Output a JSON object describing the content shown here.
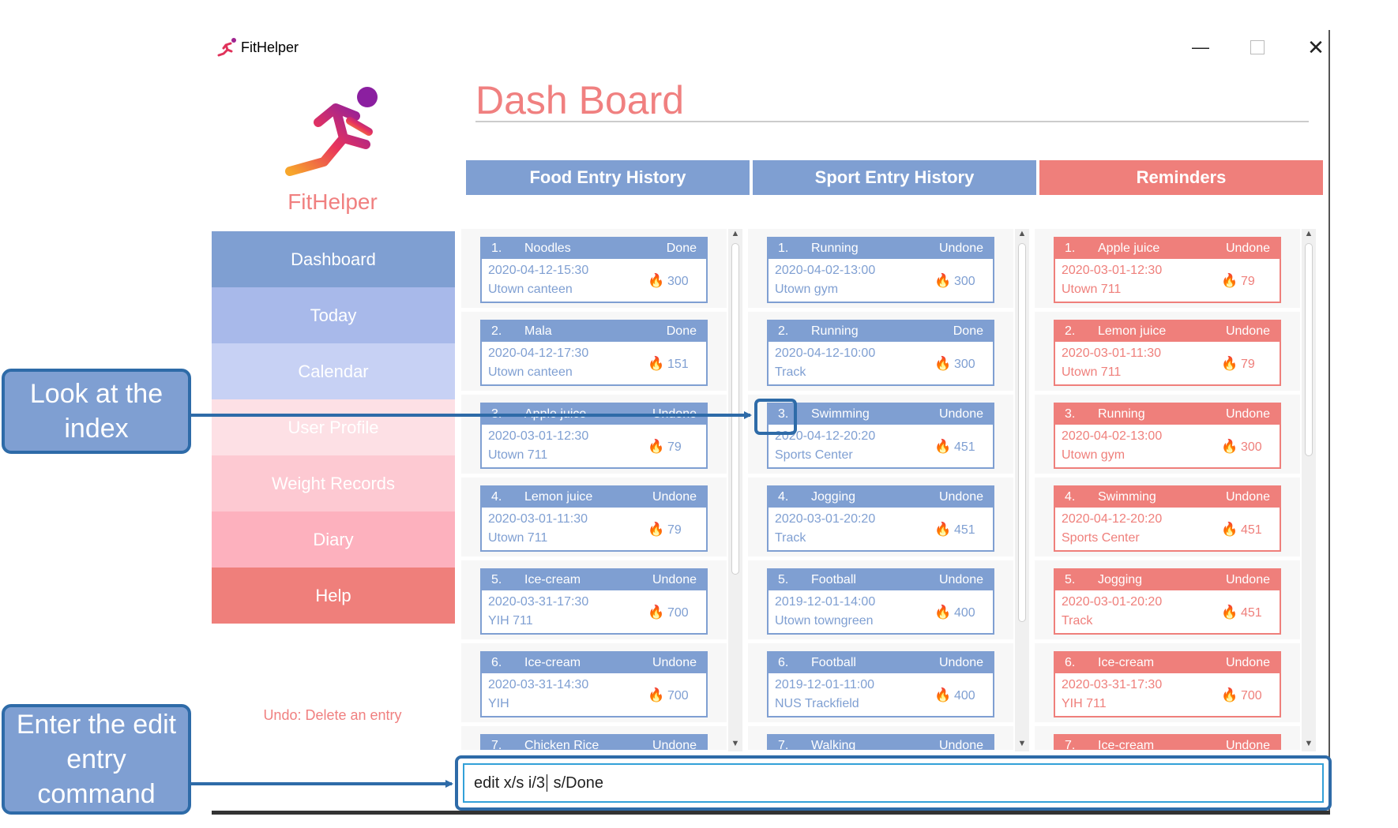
{
  "window": {
    "title": "FitHelper",
    "controls": [
      "minimize",
      "maximize",
      "close"
    ]
  },
  "sidebar": {
    "brand": "FitHelper",
    "items": [
      {
        "label": "Dashboard",
        "color": "#7f9fd2"
      },
      {
        "label": "Today",
        "color": "#a8b9ea"
      },
      {
        "label": "Calendar",
        "color": "#c7d1f4"
      },
      {
        "label": "User Profile",
        "color": "#fde0e5"
      },
      {
        "label": "Weight Records",
        "color": "#fdc9d2"
      },
      {
        "label": "Diary",
        "color": "#fdb1be"
      },
      {
        "label": "Help",
        "color": "#ef7f7b"
      }
    ],
    "status": "Undo: Delete an entry"
  },
  "main": {
    "title": "Dash Board",
    "columns": [
      {
        "title": "Food Entry History",
        "color": "#7f9fd2"
      },
      {
        "title": "Sport Entry History",
        "color": "#7f9fd2"
      },
      {
        "title": "Reminders",
        "color": "#ef7f7b"
      }
    ],
    "food": [
      {
        "index": "1.",
        "name": "Noodles",
        "status": "Done",
        "time": "2020-04-12-15:30",
        "location": "Utown canteen",
        "calories": "300"
      },
      {
        "index": "2.",
        "name": "Mala",
        "status": "Done",
        "time": "2020-04-12-17:30",
        "location": "Utown canteen",
        "calories": "151"
      },
      {
        "index": "3.",
        "name": "Apple juice",
        "status": "Undone",
        "time": "2020-03-01-12:30",
        "location": "Utown 711",
        "calories": "79"
      },
      {
        "index": "4.",
        "name": "Lemon juice",
        "status": "Undone",
        "time": "2020-03-01-11:30",
        "location": "Utown 711",
        "calories": "79"
      },
      {
        "index": "5.",
        "name": "Ice-cream",
        "status": "Undone",
        "time": "2020-03-31-17:30",
        "location": "YIH 711",
        "calories": "700"
      },
      {
        "index": "6.",
        "name": "Ice-cream",
        "status": "Undone",
        "time": "2020-03-31-14:30",
        "location": "YIH",
        "calories": "700"
      },
      {
        "index": "7.",
        "name": "Chicken Rice",
        "status": "Undone",
        "time": "",
        "location": "",
        "calories": ""
      }
    ],
    "sport": [
      {
        "index": "1.",
        "name": "Running",
        "status": "Undone",
        "time": "2020-04-02-13:00",
        "location": "Utown gym",
        "calories": "300"
      },
      {
        "index": "2.",
        "name": "Running",
        "status": "Done",
        "time": "2020-04-12-10:00",
        "location": "Track",
        "calories": "300"
      },
      {
        "index": "3.",
        "name": "Swimming",
        "status": "Undone",
        "time": "2020-04-12-20:20",
        "location": "Sports Center",
        "calories": "451"
      },
      {
        "index": "4.",
        "name": "Jogging",
        "status": "Undone",
        "time": "2020-03-01-20:20",
        "location": "Track",
        "calories": "451"
      },
      {
        "index": "5.",
        "name": "Football",
        "status": "Undone",
        "time": "2019-12-01-14:00",
        "location": "Utown towngreen",
        "calories": "400"
      },
      {
        "index": "6.",
        "name": "Football",
        "status": "Undone",
        "time": "2019-12-01-11:00",
        "location": "NUS Trackfield",
        "calories": "400"
      },
      {
        "index": "7.",
        "name": "Walking",
        "status": "Undone",
        "time": "",
        "location": "",
        "calories": ""
      }
    ],
    "reminders": [
      {
        "index": "1.",
        "name": "Apple juice",
        "status": "Undone",
        "time": "2020-03-01-12:30",
        "location": "Utown 711",
        "calories": "79"
      },
      {
        "index": "2.",
        "name": "Lemon juice",
        "status": "Undone",
        "time": "2020-03-01-11:30",
        "location": "Utown 711",
        "calories": "79"
      },
      {
        "index": "3.",
        "name": "Running",
        "status": "Undone",
        "time": "2020-04-02-13:00",
        "location": "Utown gym",
        "calories": "300"
      },
      {
        "index": "4.",
        "name": "Swimming",
        "status": "Undone",
        "time": "2020-04-12-20:20",
        "location": "Sports Center",
        "calories": "451"
      },
      {
        "index": "5.",
        "name": "Jogging",
        "status": "Undone",
        "time": "2020-03-01-20:20",
        "location": "Track",
        "calories": "451"
      },
      {
        "index": "6.",
        "name": "Ice-cream",
        "status": "Undone",
        "time": "2020-03-31-17:30",
        "location": "YIH 711",
        "calories": "700"
      },
      {
        "index": "7.",
        "name": "Ice-cream",
        "status": "Undone",
        "time": "",
        "location": "",
        "calories": ""
      }
    ]
  },
  "command": {
    "before_caret": "edit x/s i/3",
    "after_caret": " s/Done"
  },
  "annotations": {
    "index_callout": "Look at the index",
    "command_callout": "Enter the edit entry command",
    "callout_color": "#7f9fd2",
    "callout_border": "#2e6ba8"
  }
}
